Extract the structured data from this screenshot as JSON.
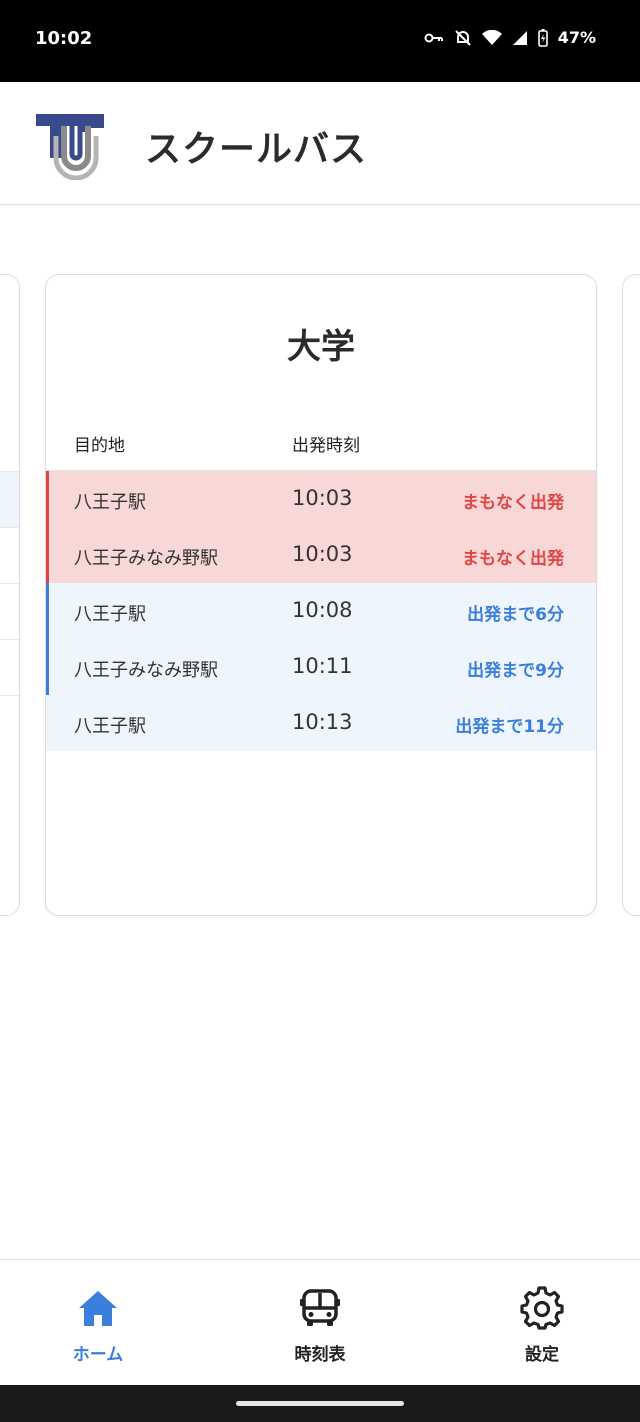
{
  "status_bar": {
    "time": "10:02",
    "battery": "47%"
  },
  "header": {
    "title": "スクールバス"
  },
  "card": {
    "title": "大学",
    "columns": {
      "destination": "目的地",
      "departure": "出発時刻"
    },
    "rows": [
      {
        "destination": "八王子駅",
        "time": "10:03",
        "status": "まもなく出発",
        "state": "soon"
      },
      {
        "destination": "八王子みなみ野駅",
        "time": "10:03",
        "status": "まもなく出発",
        "state": "soon"
      },
      {
        "destination": "八王子駅",
        "time": "10:08",
        "status": "出発まで6分",
        "state": "later"
      },
      {
        "destination": "八王子みなみ野駅",
        "time": "10:11",
        "status": "出発まで9分",
        "state": "later"
      },
      {
        "destination": "八王子駅",
        "time": "10:13",
        "status": "出発まで11分",
        "state": "later"
      }
    ]
  },
  "nav": {
    "home": {
      "label": "ホーム",
      "icon": "home-icon"
    },
    "timetable": {
      "label": "時刻表",
      "icon": "bus-icon"
    },
    "settings": {
      "label": "設定",
      "icon": "gear-icon"
    }
  },
  "colors": {
    "accent": "#3a7fdc",
    "soon": "#e04646",
    "soon_bg": "#f8d7d7",
    "later_bg": "#eff5fc"
  }
}
